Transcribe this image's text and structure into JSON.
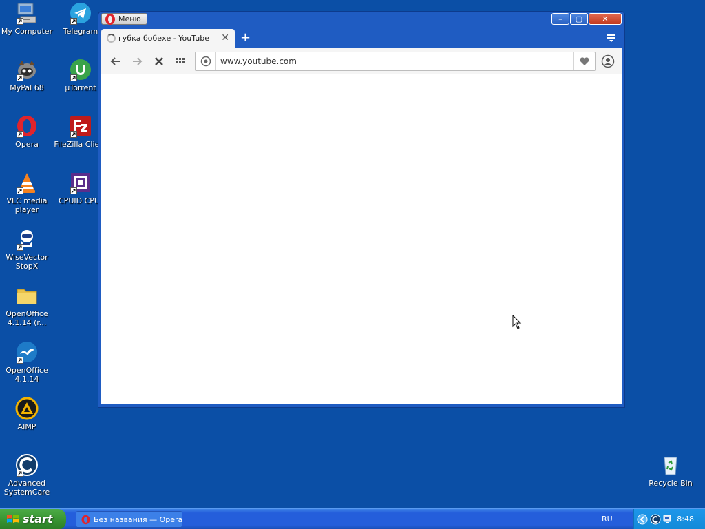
{
  "desktop": {
    "icons": [
      {
        "label": "My Computer",
        "icon": "my-computer-icon"
      },
      {
        "label": "Telegram",
        "icon": "telegram-icon"
      },
      {
        "label": "MyPal 68",
        "icon": "mypal-icon"
      },
      {
        "label": "µTorrent",
        "icon": "utorrent-icon"
      },
      {
        "label": "Opera",
        "icon": "opera-icon"
      },
      {
        "label": "FileZilla Client",
        "icon": "filezilla-icon"
      },
      {
        "label": "VLC media player",
        "icon": "vlc-icon"
      },
      {
        "label": "CPUID CPU-Z",
        "icon": "cpuz-icon"
      },
      {
        "label": "WiseVector StopX",
        "icon": "wisevector-icon"
      },
      {
        "label": "OpenOffice 4.1.14 (r...",
        "icon": "folder-icon"
      },
      {
        "label": "OpenOffice 4.1.14",
        "icon": "openoffice-icon"
      },
      {
        "label": "AIMP",
        "icon": "aimp-icon"
      },
      {
        "label": "Advanced SystemCare",
        "icon": "advanced-systemcare-icon"
      },
      {
        "label": "Recycle Bin",
        "icon": "recycle-bin-icon"
      }
    ]
  },
  "browser": {
    "menu_label": "Меню",
    "tab": {
      "title": "губка бобехе - YouTube",
      "close": "✕"
    },
    "new_tab": "+",
    "address": {
      "value": "www.youtube.com"
    },
    "window_controls": {
      "minimize": "–",
      "maximize": "▢",
      "close": "✕"
    }
  },
  "taskbar": {
    "start_label": "start",
    "task_item": "Без названия — Opera",
    "language": "RU",
    "clock": "8:48"
  },
  "colors": {
    "desktop": "#0b4fa6",
    "window_frame": "#1f5cc2",
    "taskbar": "#245edb",
    "start": "#36912f",
    "opera_red": "#e0242c"
  }
}
